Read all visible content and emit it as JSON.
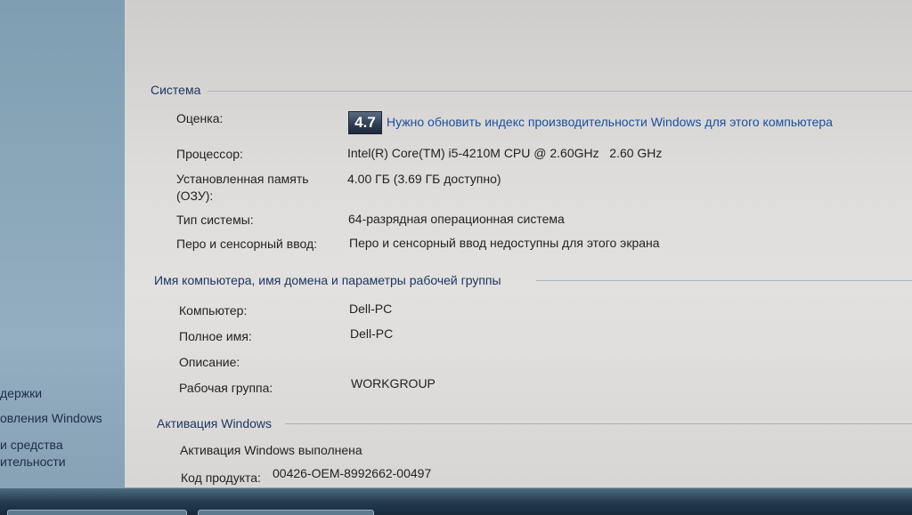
{
  "left_nav": {
    "items": [
      {
        "label": "держки"
      },
      {
        "label": "овления Windows"
      },
      {
        "label": "и средства"
      },
      {
        "label": "ительности"
      }
    ]
  },
  "system": {
    "title": "Система",
    "rating_label": "Оценка:",
    "rating_value": "4.7",
    "rating_link": "Нужно обновить индекс производительности Windows для этого компьютера",
    "processor_label": "Процессор:",
    "processor_value": "Intel(R) Core(TM) i5-4210M CPU @ 2.60GHz   2.60 GHz",
    "memory_label_1": "Установленная память",
    "memory_label_2": "(ОЗУ):",
    "memory_value": "4.00 ГБ (3.69 ГБ доступно)",
    "type_label": "Тип системы:",
    "type_value": "64-разрядная операционная система",
    "pen_label": "Перо и сенсорный ввод:",
    "pen_value": "Перо и сенсорный ввод недоступны для этого экрана"
  },
  "computer": {
    "title": "Имя компьютера, имя домена и параметры рабочей группы",
    "computer_label": "Компьютер:",
    "computer_value": "Dell-PC",
    "fullname_label": "Полное имя:",
    "fullname_value": "Dell-PC",
    "description_label": "Описание:",
    "workgroup_label": "Рабочая группа:",
    "workgroup_value": "WORKGROUP"
  },
  "activation": {
    "title": "Активация Windows",
    "status": "Активация Windows выполнена",
    "product_key_label": "Код продукта:",
    "product_key_value": "00426-OEM-8992662-00497"
  },
  "colors": {
    "link": "#1a4fa0",
    "section_title": "#1e3564",
    "badge_bg": "#2e3c52"
  }
}
